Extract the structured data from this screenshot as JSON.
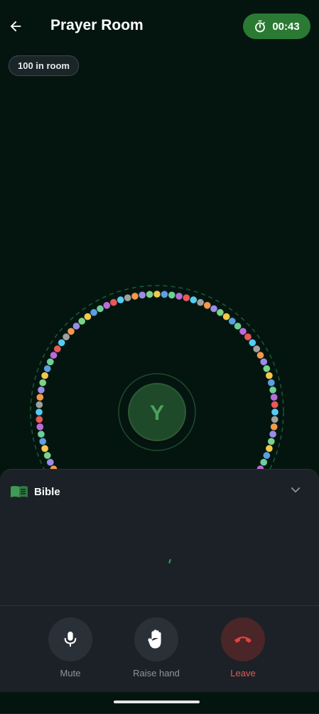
{
  "header": {
    "title": "Prayer Room",
    "timer": "00:43",
    "back_icon": "arrow-left-icon",
    "timer_icon": "stopwatch-icon"
  },
  "room": {
    "count_label": "100 in room"
  },
  "center": {
    "avatar_letter": "Y"
  },
  "sheet": {
    "title": "Bible",
    "icon": "book-icon",
    "toggle_icon": "chevron-down-icon"
  },
  "controls": [
    {
      "label": "Mute",
      "icon": "microphone-icon"
    },
    {
      "label": "Raise hand",
      "icon": "hand-icon"
    },
    {
      "label": "Leave",
      "icon": "phone-hangup-icon"
    }
  ],
  "colors": {
    "accent_green": "#2b7a33",
    "danger": "#e35a55",
    "bg": "#041510"
  }
}
